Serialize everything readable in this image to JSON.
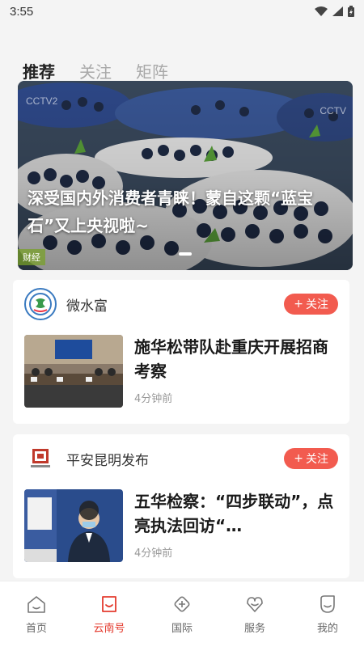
{
  "status": {
    "time": "3:55"
  },
  "tabs": [
    {
      "label": "推荐",
      "active": true
    },
    {
      "label": "关注",
      "active": false
    },
    {
      "label": "矩阵",
      "active": false
    }
  ],
  "banner": {
    "title": "深受国内外消费者青睐！蒙自这颗“蓝宝石”又上央视啦~",
    "tag": "财经",
    "logo_left": "CCTV2",
    "logo_right": "CCTV"
  },
  "cards": [
    {
      "source": "微水富",
      "follow_label": "关注",
      "title": "施华松带队赴重庆开展招商考察",
      "time": "4分钟前"
    },
    {
      "source": "平安昆明发布",
      "follow_label": "关注",
      "title": "五华检察：“四步联动”，点亮执法回访“…",
      "time": "4分钟前"
    }
  ],
  "nav": [
    {
      "label": "首页",
      "icon": "home-icon",
      "active": false
    },
    {
      "label": "云南号",
      "icon": "yunnan-icon",
      "active": true
    },
    {
      "label": "国际",
      "icon": "globe-icon",
      "active": false
    },
    {
      "label": "服务",
      "icon": "service-icon",
      "active": false
    },
    {
      "label": "我的",
      "icon": "profile-icon",
      "active": false
    }
  ],
  "colors": {
    "accent": "#e43b2e",
    "follow": "#f25b4f"
  }
}
